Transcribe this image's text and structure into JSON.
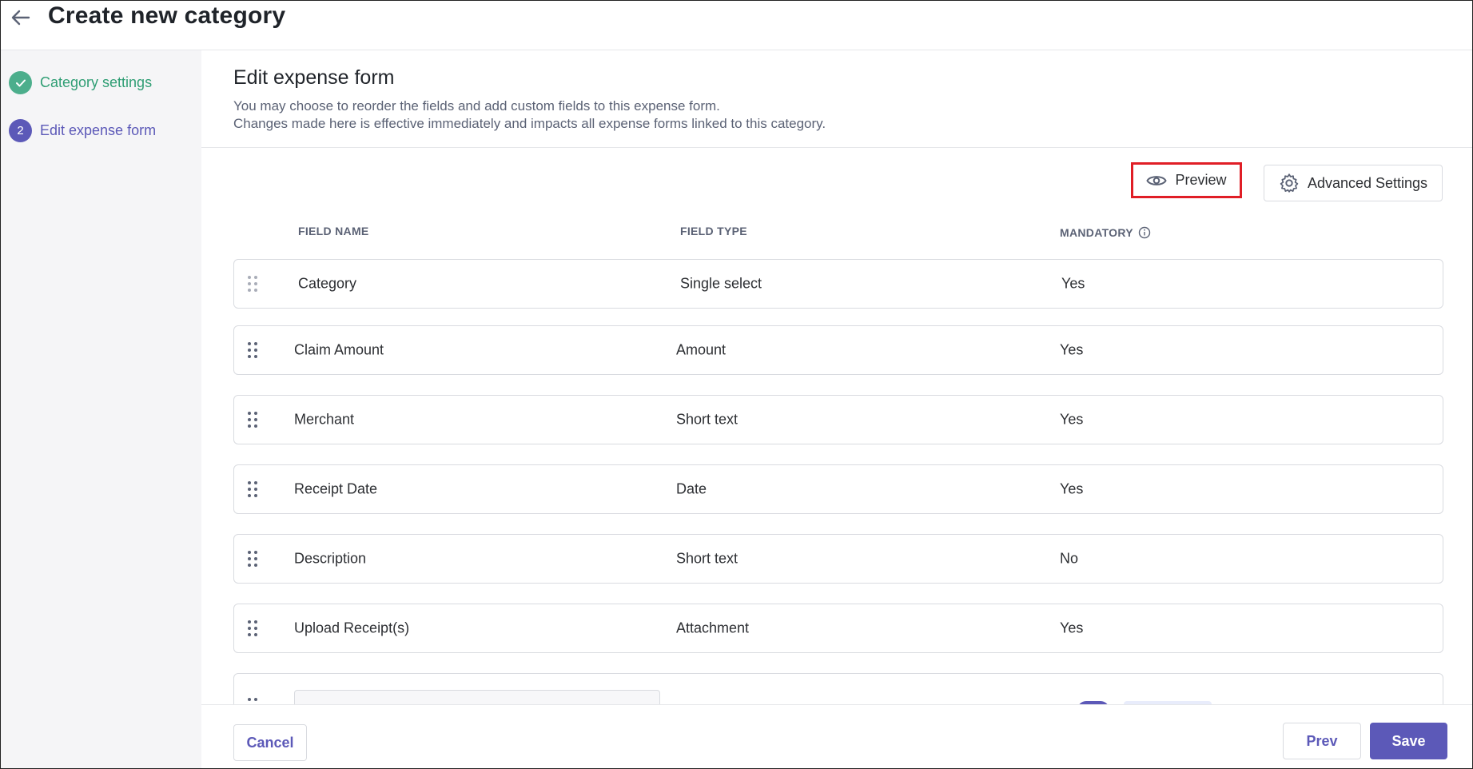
{
  "header": {
    "title": "Create new category"
  },
  "sidebar": {
    "steps": [
      {
        "number": "",
        "label": "Category settings",
        "status": "completed"
      },
      {
        "number": "2",
        "label": "Edit expense form",
        "status": "active"
      }
    ]
  },
  "form": {
    "title": "Edit expense form",
    "description_line1": "You may choose to reorder the fields and add custom fields to this expense form.",
    "description_line2": "Changes made here is effective immediately and impacts all expense forms linked to this category."
  },
  "toolbar": {
    "preview_label": "Preview",
    "advanced_label": "Advanced Settings"
  },
  "table": {
    "columns": {
      "name": "FIELD NAME",
      "type": "FIELD TYPE",
      "mandatory": "MANDATORY"
    },
    "rows": [
      {
        "name": "Category",
        "type": "Single select",
        "mandatory": "Yes"
      },
      {
        "name": "Claim Amount",
        "type": "Amount",
        "mandatory": "Yes"
      },
      {
        "name": "Merchant",
        "type": "Short text",
        "mandatory": "Yes"
      },
      {
        "name": "Receipt Date",
        "type": "Date",
        "mandatory": "Yes"
      },
      {
        "name": "Description",
        "type": "Short text",
        "mandatory": "No"
      },
      {
        "name": "Upload Receipt(s)",
        "type": "Attachment",
        "mandatory": "Yes"
      }
    ]
  },
  "footer": {
    "cancel_label": "Cancel",
    "prev_label": "Prev",
    "save_label": "Save"
  },
  "colors": {
    "accent": "#5c59b8",
    "success": "#4cae8c",
    "highlight": "#e01e26"
  }
}
